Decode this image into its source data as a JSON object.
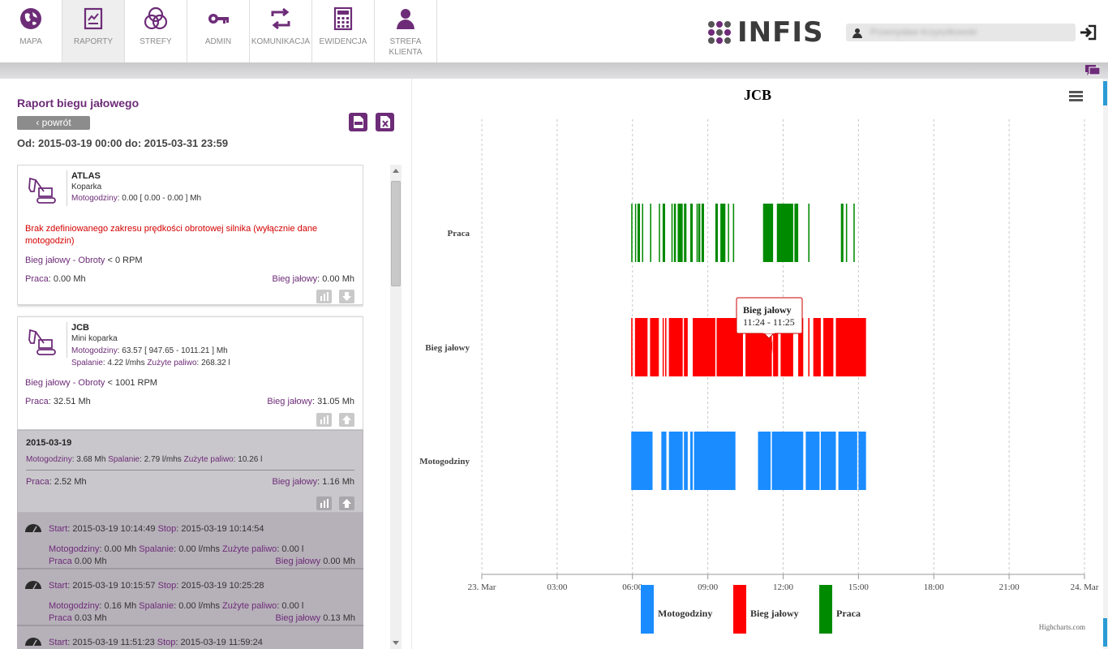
{
  "nav": [
    {
      "label": "MAPA",
      "icon": "globe-icon"
    },
    {
      "label": "RAPORTY",
      "icon": "report-icon"
    },
    {
      "label": "STREFY",
      "icon": "zones-icon"
    },
    {
      "label": "ADMIN",
      "icon": "key-icon"
    },
    {
      "label": "KOMUNIKACJA",
      "icon": "exchange-icon"
    },
    {
      "label": "EWIDENCJA",
      "icon": "calculator-icon"
    },
    {
      "label": "STREFA KLIENTA",
      "icon": "person-icon"
    }
  ],
  "brand": "INFIS",
  "user": {
    "name": "Przemysław Krzysztkowski"
  },
  "report": {
    "title": "Raport biegu jałowego",
    "back": "‹ powrót",
    "range": "Od: 2015-03-19 00:00 do: 2015-03-31 23:59"
  },
  "machines": [
    {
      "name": "ATLAS",
      "type": "Koparka",
      "moto_label": "Motogodziny",
      "moto_value": ": 0.00 [ 0.00 - 0.00 ] Mh",
      "warning": "Brak zdefiniowanego zakresu prędkości obrotowej silnika (wyłącznie dane motogodzin)",
      "idle_label": "Bieg jałowy - Obroty",
      "idle_value": " < 0 RPM",
      "work_label": "Praca",
      "work_value": ": 0.00 Mh",
      "idle_sum_label": "Bieg jałowy",
      "idle_sum_value": ": 0.00 Mh"
    },
    {
      "name": "JCB",
      "type": "Mini koparka",
      "moto_label": "Motogodziny",
      "moto_value": ": 63.57 [ 947.65 - 1011.21 ] Mh",
      "burn_label": "Spalanie",
      "burn_value": ": 4.22 l/mhs",
      "fuel_label": "Zużyte paliwo",
      "fuel_value": ": 268.32 l",
      "idle_label": "Bieg jałowy - Obroty",
      "idle_value": " < 1001 RPM",
      "work_label": "Praca",
      "work_value": ": 32.51 Mh",
      "idle_sum_label": "Bieg jałowy",
      "idle_sum_value": ": 31.05 Mh"
    }
  ],
  "day": {
    "date": "2015-03-19",
    "moto_label": "Motogodziny",
    "moto_value": ": 3.68 Mh",
    "burn_label": "Spalanie",
    "burn_value": ": 2.79 l/mhs",
    "fuel_label": "Zużyte paliwo",
    "fuel_value": ": 10.26 l",
    "work_label": "Praca",
    "work_value": ": 2.52 Mh",
    "idle_label": "Bieg jałowy",
    "idle_value": ": 1.16 Mh"
  },
  "segments": [
    {
      "start": "2015-03-19 10:14:49",
      "stop": "2015-03-19 10:14:54",
      "moto": ": 0.00 Mh",
      "burn": ": 0.00 l/mhs",
      "fuel": ": 0.00 l",
      "work": "0.00 Mh",
      "idle": "0.00 Mh"
    },
    {
      "start": "2015-03-19 10:15:57",
      "stop": "2015-03-19 10:25:28",
      "moto": ": 0.16 Mh",
      "burn": ": 0.00 l/mhs",
      "fuel": ": 0.00 l",
      "work": "0.03 Mh",
      "idle": "0.13 Mh"
    },
    {
      "start": "2015-03-19 11:51:23",
      "stop": "2015-03-19 11:59:24"
    }
  ],
  "seg_labels": {
    "start": "Start",
    "stop": "Stop",
    "moto": "Motogodziny",
    "burn": "Spalanie",
    "fuel": "Zużyte paliwo",
    "work": "Praca",
    "idle": "Bieg jałowy"
  },
  "tooltip": {
    "title": "Bieg jałowy",
    "time": "11:24 - 11:25"
  },
  "credits": "Highcharts.com",
  "chart_data": {
    "type": "timeline",
    "title": "JCB",
    "categories": [
      "Praca",
      "Bieg jałowy",
      "Motogodziny"
    ],
    "x_ticks": [
      "23. Mar",
      "03:00",
      "06:00",
      "09:00",
      "12:00",
      "15:00",
      "18:00",
      "21:00",
      "24. Mar"
    ],
    "x_range_hours": [
      0,
      24
    ],
    "legend": [
      {
        "name": "Motogodziny",
        "color": "#1a8cff"
      },
      {
        "name": "Bieg jałowy",
        "color": "#ff0000"
      },
      {
        "name": "Praca",
        "color": "#008a00"
      }
    ],
    "series": [
      {
        "name": "Praca",
        "color": "#008a00",
        "intervals": [
          [
            5.95,
            6.0
          ],
          [
            6.1,
            6.13
          ],
          [
            6.2,
            6.3
          ],
          [
            6.38,
            6.42
          ],
          [
            6.7,
            6.75
          ],
          [
            7.05,
            7.08
          ],
          [
            7.2,
            7.3
          ],
          [
            7.55,
            7.6
          ],
          [
            7.65,
            7.73
          ],
          [
            7.8,
            8.0
          ],
          [
            8.05,
            8.15
          ],
          [
            8.3,
            8.4
          ],
          [
            8.55,
            8.6
          ],
          [
            8.62,
            8.7
          ],
          [
            8.75,
            8.85
          ],
          [
            9.3,
            9.4
          ],
          [
            9.5,
            9.7
          ],
          [
            9.8,
            9.82
          ],
          [
            10.0,
            10.05
          ],
          [
            11.2,
            11.6
          ],
          [
            11.75,
            12.4
          ],
          [
            12.45,
            12.6
          ],
          [
            13.0,
            13.05
          ],
          [
            14.3,
            14.4
          ],
          [
            14.5,
            14.55
          ],
          [
            14.8,
            14.85
          ]
        ]
      },
      {
        "name": "Bieg jałowy",
        "color": "#ff0000",
        "intervals": [
          [
            5.95,
            6.0
          ],
          [
            6.1,
            6.6
          ],
          [
            6.7,
            7.05
          ],
          [
            7.2,
            7.22
          ],
          [
            7.3,
            7.35
          ],
          [
            7.45,
            8.0
          ],
          [
            8.05,
            8.2
          ],
          [
            8.4,
            9.3
          ],
          [
            9.35,
            10.4
          ],
          [
            10.5,
            11.55
          ],
          [
            11.6,
            11.8
          ],
          [
            11.9,
            12.4
          ],
          [
            12.6,
            12.8
          ],
          [
            13.0,
            13.05
          ],
          [
            13.2,
            13.5
          ],
          [
            13.6,
            14.0
          ],
          [
            14.1,
            15.3
          ]
        ]
      },
      {
        "name": "Motogodziny",
        "color": "#1a8cff",
        "intervals": [
          [
            5.95,
            6.8
          ],
          [
            7.15,
            7.35
          ],
          [
            7.45,
            8.0
          ],
          [
            8.05,
            8.2
          ],
          [
            8.3,
            8.4
          ],
          [
            8.45,
            10.1
          ],
          [
            11.0,
            11.5
          ],
          [
            11.55,
            12.8
          ],
          [
            12.9,
            13.45
          ],
          [
            13.5,
            14.1
          ],
          [
            14.2,
            14.95
          ],
          [
            15.0,
            15.3
          ]
        ]
      }
    ]
  }
}
